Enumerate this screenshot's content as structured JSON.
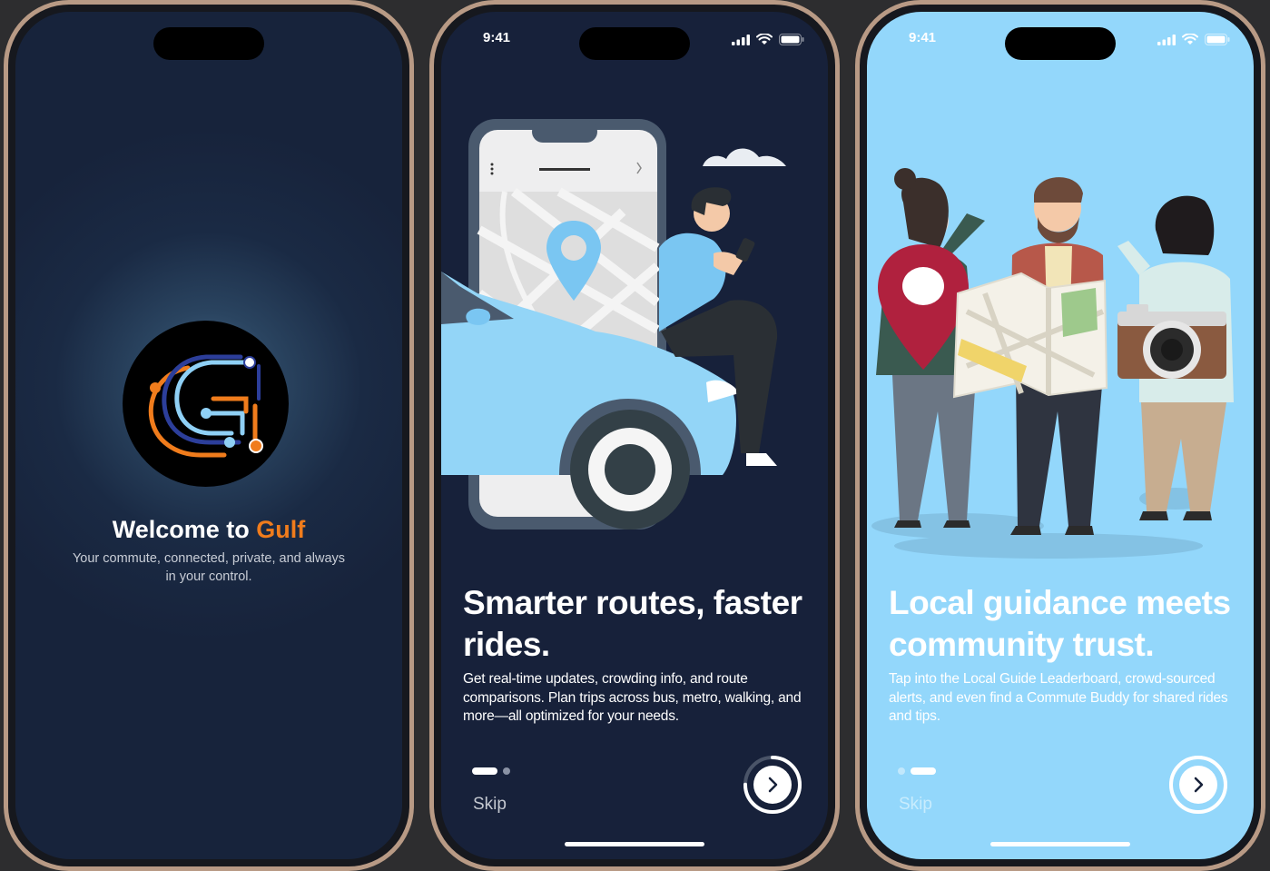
{
  "screens": [
    {
      "id": "welcome",
      "title_prefix": "Welcome to ",
      "title_brand": "Gulf",
      "subtitle": "Your commute, connected, private, and always in your control."
    },
    {
      "id": "onboarding-routes",
      "time": "9:41",
      "headline": "Smarter routes, faster rides.",
      "body": "Get real-time updates, crowding info, and route comparisons. Plan trips across bus, metro, walking, and more—all optimized for your needs.",
      "skip_label": "Skip",
      "page_index": 1,
      "page_count": 2,
      "progress": 0.75
    },
    {
      "id": "onboarding-community",
      "time": "9:41",
      "headline": "Local guidance meets community trust.",
      "body": "Tap into the Local Guide Leaderboard, crowd-sourced alerts, and even find a Commute Buddy for shared rides and tips.",
      "skip_label": "Skip",
      "page_index": 2,
      "page_count": 2,
      "progress": 1.0
    }
  ],
  "colors": {
    "brand_orange": "#f07c1c",
    "dark_navy": "#17213a",
    "sky_blue": "#93d7fb",
    "phone_frame": "#b89a85"
  },
  "icons": [
    "signal-icon",
    "wifi-icon",
    "battery-icon",
    "chevron-right-icon",
    "gulf-logo-icon"
  ]
}
